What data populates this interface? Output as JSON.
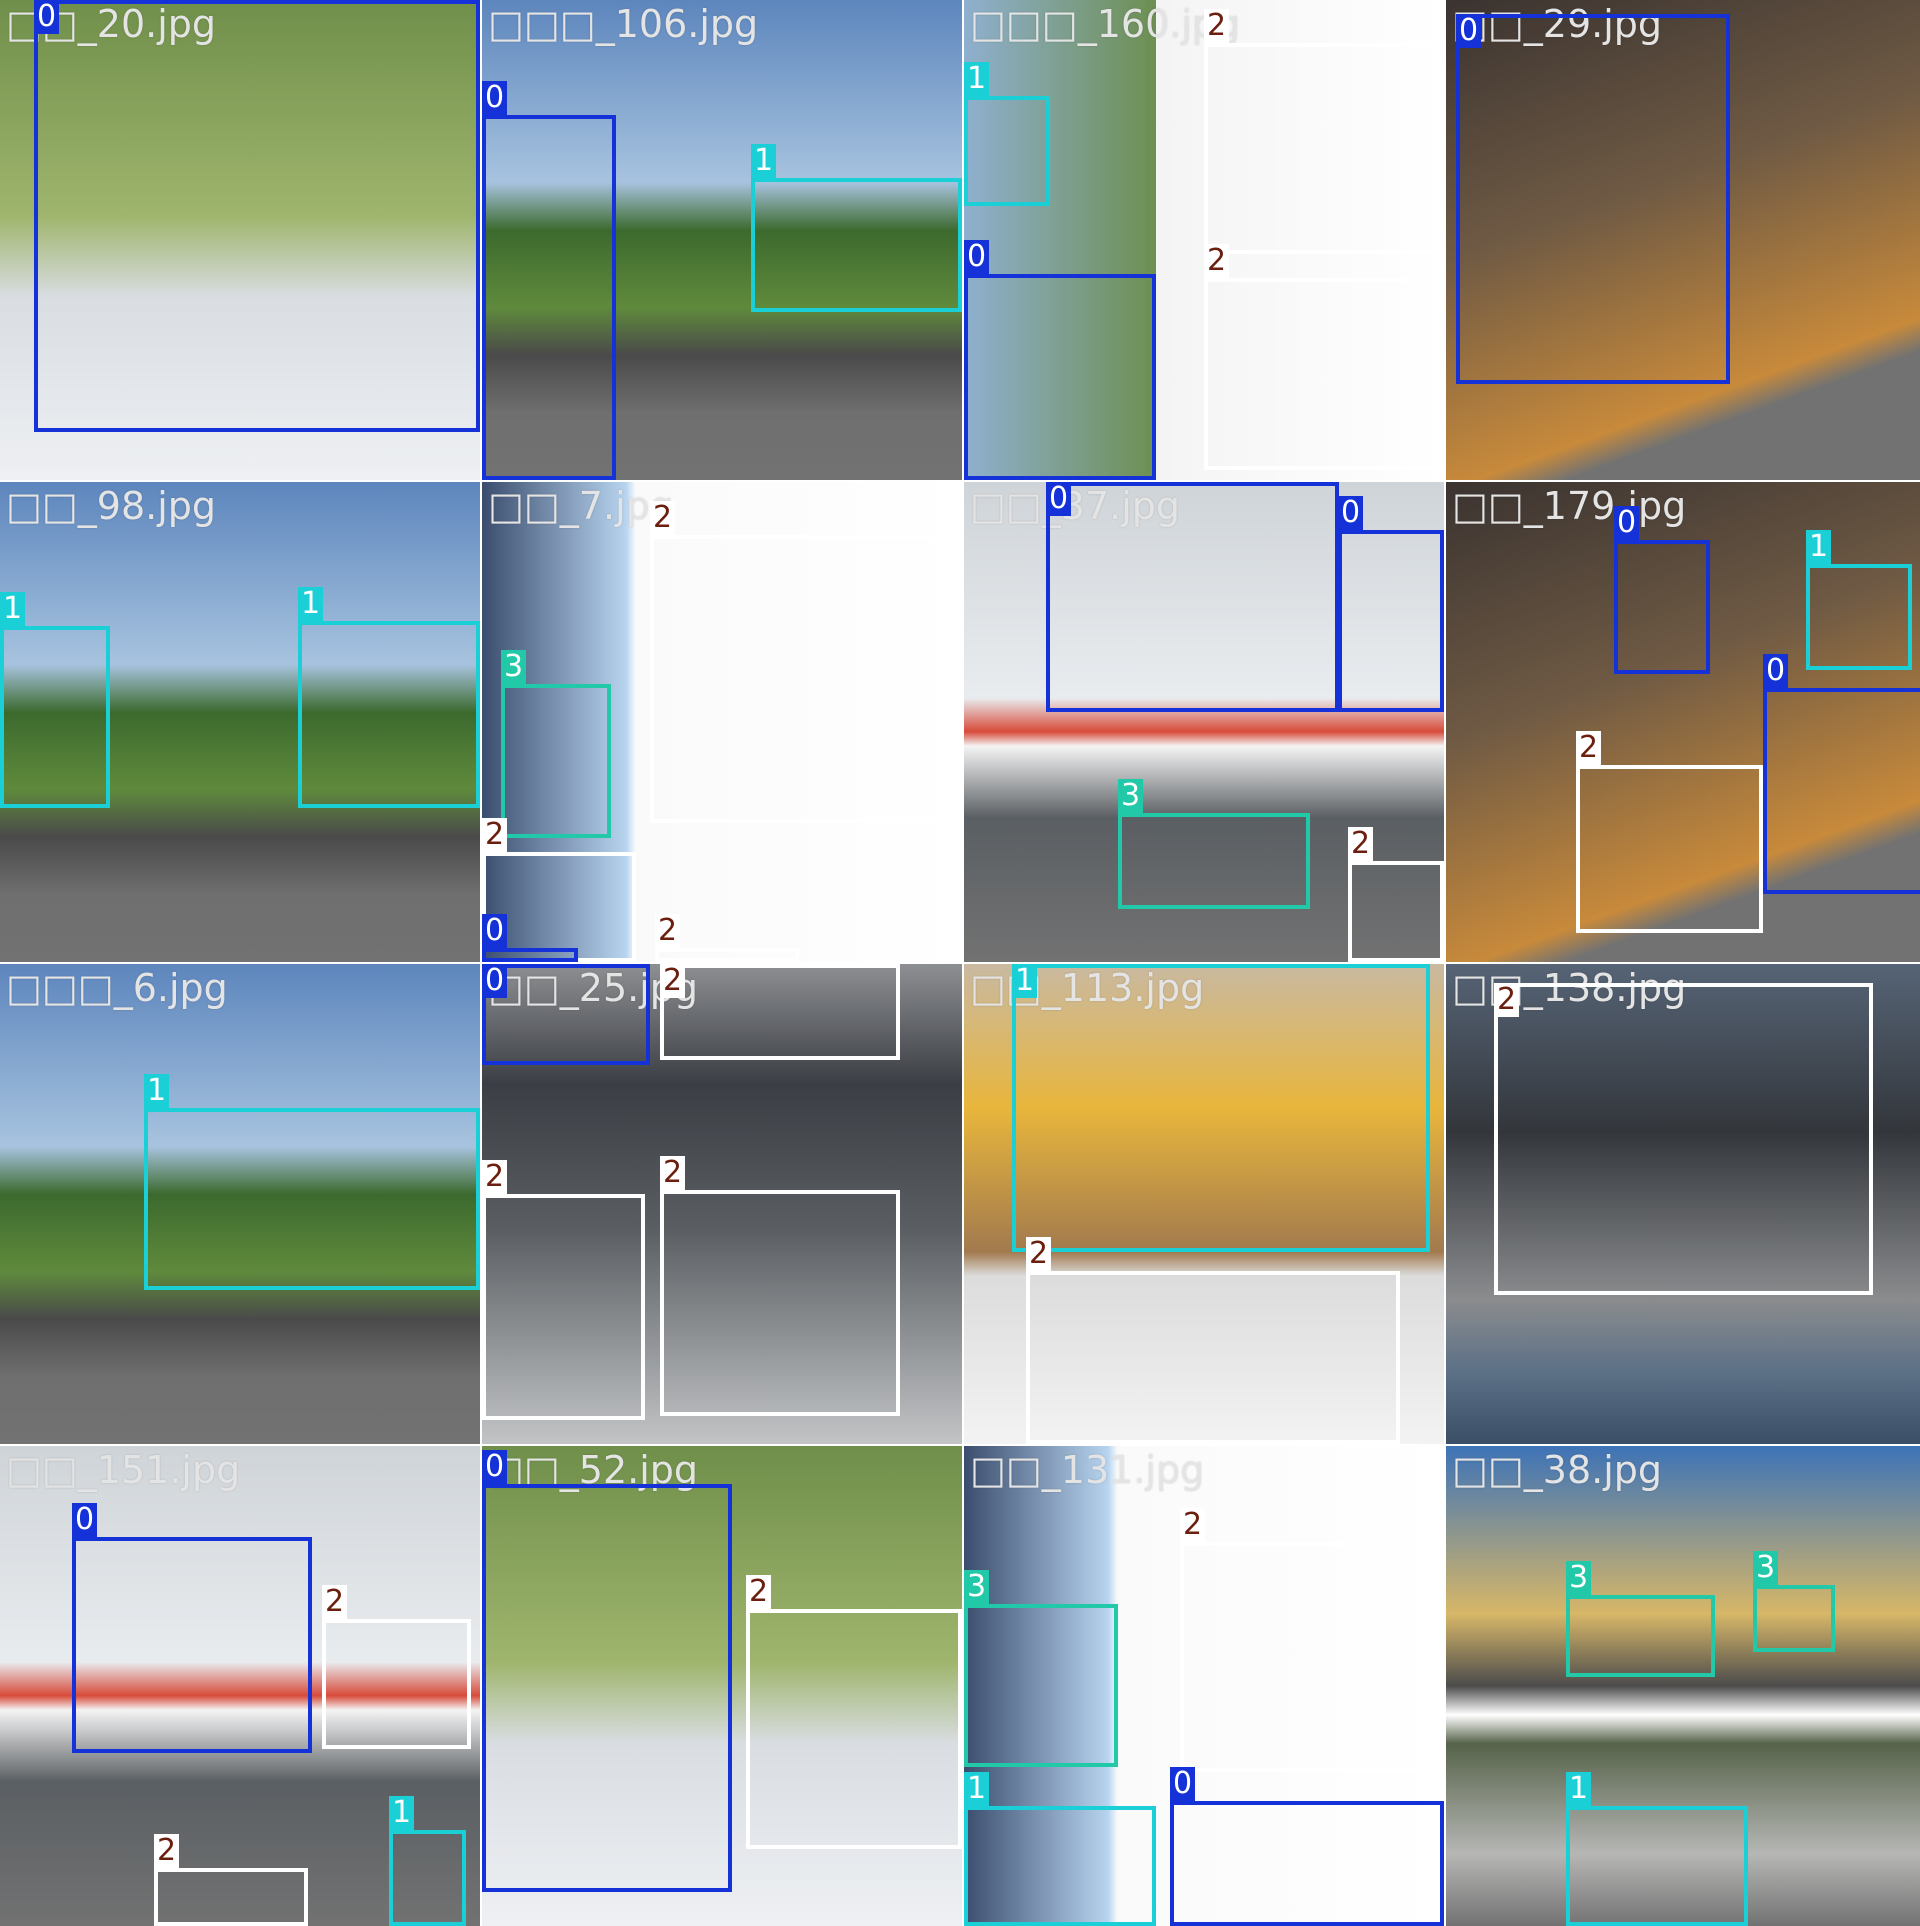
{
  "colors": {
    "class_0": "#1432d8",
    "class_1": "#1ad0d6",
    "class_2": "#ffffff",
    "class_3": "#22c9a8",
    "tile_background": "#727272"
  },
  "tiles": [
    {
      "id": "t00",
      "filename": "□□_20.jpg",
      "scene": "bike-teal",
      "boxes": [
        {
          "c": "0",
          "l": 0.07,
          "t": 0.0,
          "w": 0.93,
          "h": 0.9
        }
      ]
    },
    {
      "id": "t01",
      "filename": "□□□_106.jpg",
      "scene": "truck-road",
      "boxes": [
        {
          "c": "0",
          "l": 0.0,
          "t": 0.24,
          "w": 0.28,
          "h": 0.76
        },
        {
          "c": "1",
          "l": 0.56,
          "t": 0.37,
          "w": 0.44,
          "h": 0.28
        }
      ]
    },
    {
      "id": "t02",
      "filename": "□□□_160.jpg",
      "scene": "moto-silver",
      "boxes": [
        {
          "c": "1",
          "l": 0.0,
          "t": 0.2,
          "w": 0.18,
          "h": 0.23
        },
        {
          "c": "0",
          "l": 0.0,
          "t": 0.57,
          "w": 0.4,
          "h": 0.43
        },
        {
          "c": "2",
          "l": 0.5,
          "t": 0.09,
          "w": 0.5,
          "h": 0.44
        },
        {
          "c": "2",
          "l": 0.5,
          "t": 0.58,
          "w": 0.5,
          "h": 0.4
        }
      ]
    },
    {
      "id": "t03",
      "filename": "□□_29.jpg",
      "scene": "bike-yellow",
      "boxes": [
        {
          "c": "0",
          "l": 0.02,
          "t": 0.03,
          "w": 0.57,
          "h": 0.77
        }
      ]
    },
    {
      "id": "t10",
      "filename": "□□_98.jpg",
      "scene": "truck-road",
      "boxes": [
        {
          "c": "1",
          "l": 0.0,
          "t": 0.3,
          "w": 0.23,
          "h": 0.38
        },
        {
          "c": "1",
          "l": 0.62,
          "t": 0.29,
          "w": 0.38,
          "h": 0.39
        }
      ]
    },
    {
      "id": "t11",
      "filename": "□□_7.jpg",
      "scene": "moto-adv",
      "boxes": [
        {
          "c": "3",
          "l": 0.04,
          "t": 0.42,
          "w": 0.23,
          "h": 0.32
        },
        {
          "c": "2",
          "l": 0.35,
          "t": 0.11,
          "w": 0.65,
          "h": 0.6
        },
        {
          "c": "2",
          "l": 0.0,
          "t": 0.77,
          "w": 0.32,
          "h": 0.23
        },
        {
          "c": "0",
          "l": 0.0,
          "t": 0.97,
          "w": 0.2,
          "h": 0.03
        },
        {
          "c": "2",
          "l": 0.36,
          "t": 0.97,
          "w": 0.3,
          "h": 0.03
        }
      ]
    },
    {
      "id": "t12",
      "filename": "□□_37.jpg",
      "scene": "bike-lightblue",
      "boxes": [
        {
          "c": "0",
          "l": 0.17,
          "t": 0.0,
          "w": 0.61,
          "h": 0.48
        },
        {
          "c": "0",
          "l": 0.78,
          "t": 0.1,
          "w": 0.22,
          "h": 0.38
        },
        {
          "c": "3",
          "l": 0.32,
          "t": 0.69,
          "w": 0.4,
          "h": 0.2
        },
        {
          "c": "2",
          "l": 0.8,
          "t": 0.79,
          "w": 0.2,
          "h": 0.21
        }
      ]
    },
    {
      "id": "t13",
      "filename": "□□_179.jpg",
      "scene": "bike-yellow",
      "boxes": [
        {
          "c": "0",
          "l": 0.35,
          "t": 0.12,
          "w": 0.2,
          "h": 0.28
        },
        {
          "c": "1",
          "l": 0.75,
          "t": 0.17,
          "w": 0.22,
          "h": 0.22
        },
        {
          "c": "0",
          "l": 0.66,
          "t": 0.43,
          "w": 0.34,
          "h": 0.43
        },
        {
          "c": "2",
          "l": 0.27,
          "t": 0.59,
          "w": 0.39,
          "h": 0.35
        }
      ]
    },
    {
      "id": "t20",
      "filename": "□□□_6.jpg",
      "scene": "truck-road",
      "boxes": [
        {
          "c": "1",
          "l": 0.3,
          "t": 0.3,
          "w": 0.7,
          "h": 0.38
        }
      ]
    },
    {
      "id": "t21",
      "filename": "□□_25.jpg",
      "scene": "moto-garage",
      "boxes": [
        {
          "c": "0",
          "l": 0.0,
          "t": 0.0,
          "w": 0.35,
          "h": 0.21
        },
        {
          "c": "2",
          "l": 0.37,
          "t": 0.0,
          "w": 0.5,
          "h": 0.2
        },
        {
          "c": "2",
          "l": 0.0,
          "t": 0.48,
          "w": 0.34,
          "h": 0.47
        },
        {
          "c": "2",
          "l": 0.37,
          "t": 0.47,
          "w": 0.5,
          "h": 0.47
        }
      ]
    },
    {
      "id": "t22",
      "filename": "□□_113.jpg",
      "scene": "dump-truck",
      "boxes": [
        {
          "c": "1",
          "l": 0.1,
          "t": 0.0,
          "w": 0.87,
          "h": 0.6
        },
        {
          "c": "2",
          "l": 0.13,
          "t": 0.64,
          "w": 0.78,
          "h": 0.36
        }
      ]
    },
    {
      "id": "t23",
      "filename": "□□_138.jpg",
      "scene": "moto-adv-street",
      "boxes": [
        {
          "c": "2",
          "l": 0.1,
          "t": 0.04,
          "w": 0.79,
          "h": 0.65
        }
      ]
    },
    {
      "id": "t30",
      "filename": "□□_151.jpg",
      "scene": "bike-lightblue",
      "boxes": [
        {
          "c": "0",
          "l": 0.15,
          "t": 0.19,
          "w": 0.5,
          "h": 0.45
        },
        {
          "c": "2",
          "l": 0.67,
          "t": 0.36,
          "w": 0.31,
          "h": 0.27
        },
        {
          "c": "1",
          "l": 0.81,
          "t": 0.8,
          "w": 0.16,
          "h": 0.2
        },
        {
          "c": "2",
          "l": 0.32,
          "t": 0.88,
          "w": 0.32,
          "h": 0.12
        }
      ]
    },
    {
      "id": "t31",
      "filename": "□□_52.jpg",
      "scene": "bike-teal",
      "boxes": [
        {
          "c": "0",
          "l": 0.0,
          "t": 0.08,
          "w": 0.52,
          "h": 0.85
        },
        {
          "c": "2",
          "l": 0.55,
          "t": 0.34,
          "w": 0.45,
          "h": 0.5
        }
      ]
    },
    {
      "id": "t32",
      "filename": "□□_131.jpg",
      "scene": "moto-adv",
      "boxes": [
        {
          "c": "3",
          "l": 0.0,
          "t": 0.33,
          "w": 0.32,
          "h": 0.34
        },
        {
          "c": "2",
          "l": 0.45,
          "t": 0.2,
          "w": 0.55,
          "h": 0.48
        },
        {
          "c": "1",
          "l": 0.0,
          "t": 0.75,
          "w": 0.4,
          "h": 0.25
        },
        {
          "c": "0",
          "l": 0.43,
          "t": 0.74,
          "w": 0.57,
          "h": 0.26
        }
      ]
    },
    {
      "id": "t33",
      "filename": "□□_38.jpg",
      "scene": "car-road",
      "boxes": [
        {
          "c": "3",
          "l": 0.25,
          "t": 0.31,
          "w": 0.31,
          "h": 0.17
        },
        {
          "c": "3",
          "l": 0.64,
          "t": 0.29,
          "w": 0.17,
          "h": 0.14
        },
        {
          "c": "1",
          "l": 0.25,
          "t": 0.75,
          "w": 0.38,
          "h": 0.25
        }
      ]
    }
  ]
}
